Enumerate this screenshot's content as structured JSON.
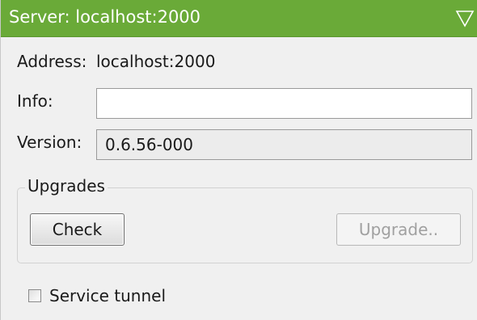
{
  "panel": {
    "title": "Server: localhost:2000",
    "header_color": "#6aaa38",
    "collapse_icon": "triangle-down-icon"
  },
  "fields": {
    "address_label": "Address:",
    "address_value": "localhost:2000",
    "info_label": "Info:",
    "info_value": "",
    "version_label": "Version:",
    "version_value": "0.6.56-000"
  },
  "upgrades": {
    "group_label": "Upgrades",
    "check_button": "Check",
    "upgrade_button": "Upgrade.."
  },
  "service_tunnel": {
    "label": "Service tunnel",
    "checked": false
  }
}
